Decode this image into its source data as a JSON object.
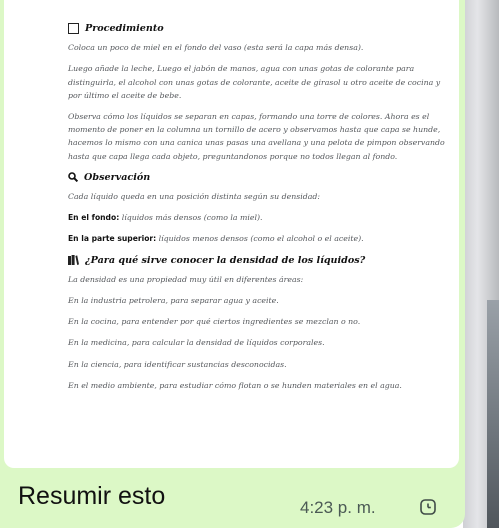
{
  "document": {
    "section_procedure": {
      "heading": "Procedimiento",
      "paragraphs": [
        "Coloca un poco de miel en el fondo del vaso (esta será la capa más densa).",
        "Luego añade la leche, Luego el jabón de manos, agua con unas gotas de colorante para distinguirla, el alcohol con unas gotas de colorante, aceite de girasol u otro aceite de cocina y por último el aceite de bebe.",
        "Observa cómo los líquidos se separan en capas, formando una torre de colores. Ahora es el momento de poner en la columna un tornillo de acero y observamos hasta que capa se hunde, hacemos lo mismo con una canica unas pasas una avellana y una pelota de pimpon observando hasta que capa llega cada objeto, preguntandonos porque no todos llegan al fondo."
      ]
    },
    "section_observation": {
      "heading": "Observación",
      "intro": "Cada líquido queda en una posición distinta según su densidad:",
      "bottom_label": "En el fondo:",
      "bottom_text": " líquidos más densos (como la miel).",
      "top_label": "En la parte superior:",
      "top_text": " líquidos menos densos (como el alcohol o el aceite)."
    },
    "section_uses": {
      "heading": "¿Para qué sirve conocer la densidad de los líquidos?",
      "items": [
        "La densidad es una propiedad muy útil en diferentes áreas:",
        "En la industria petrolera, para separar agua y aceite.",
        "En la cocina, para entender por qué ciertos ingredientes se mezclan o no.",
        "En la medicina, para calcular la densidad de líquidos corporales.",
        "En la ciencia, para identificar sustancias desconocidas.",
        "En el medio ambiente, para estudiar cómo flotan o se hunden materiales en el agua."
      ]
    }
  },
  "message": {
    "caption": "Resumir esto",
    "time": "4:23 p. m.",
    "status_icon": "clock-icon"
  },
  "colors": {
    "bubble": "#dcf8c6",
    "text_dark": "#111111",
    "text_muted": "#55585c"
  }
}
